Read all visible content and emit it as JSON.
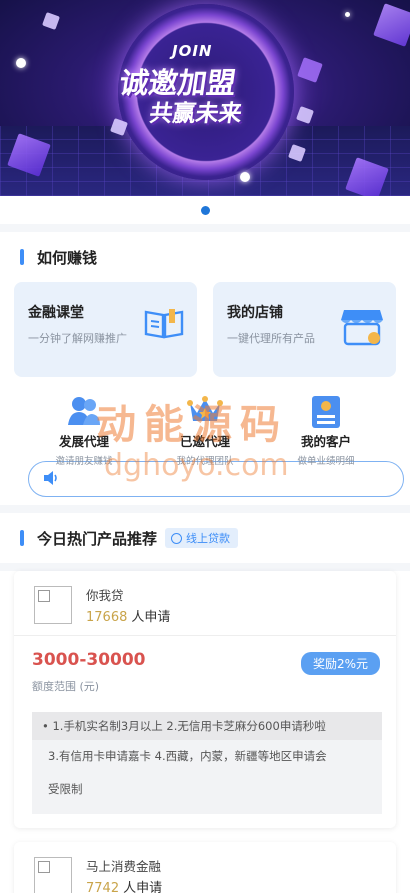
{
  "banner": {
    "join_text": "JOIN",
    "line1": "诚邀加盟",
    "line2": "共赢未来"
  },
  "earn": {
    "title": "如何赚钱",
    "cards": [
      {
        "title": "金融课堂",
        "subtitle": "一分钟了解网赚推广",
        "icon": "book-icon"
      },
      {
        "title": "我的店铺",
        "subtitle": "一键代理所有产品",
        "icon": "shop-icon"
      }
    ],
    "grid": [
      {
        "title": "发展代理",
        "subtitle": "邀请朋友赚钱",
        "icon": "users-icon"
      },
      {
        "title": "已邀代理",
        "subtitle": "我的代理团队",
        "icon": "crown-icon"
      },
      {
        "title": "我的客户",
        "subtitle": "做单业绩明细",
        "icon": "id-card-icon"
      }
    ]
  },
  "watermark": {
    "line1": "动能源码",
    "line2": "dghoyo.com"
  },
  "notice": {
    "icon": "speaker-icon",
    "text": ""
  },
  "products": {
    "title": "今日热门产品推荐",
    "tag": "线上贷款",
    "items": [
      {
        "name": "你我贷",
        "count": "17668",
        "count_suffix": "人申请",
        "amount": "3000-30000",
        "amount_label": "额度范围 (元)",
        "reward": "奖励2%元",
        "desc_lines": [
          "1.手机实名制3月以上 2.无信用卡芝麻分600申请秒啦",
          "3.有信用卡申请嘉卡 4.西藏，内蒙，新疆等地区申请会",
          "受限制"
        ]
      },
      {
        "name": "马上消费金融",
        "count": "7742",
        "count_suffix": "人申请"
      }
    ]
  }
}
